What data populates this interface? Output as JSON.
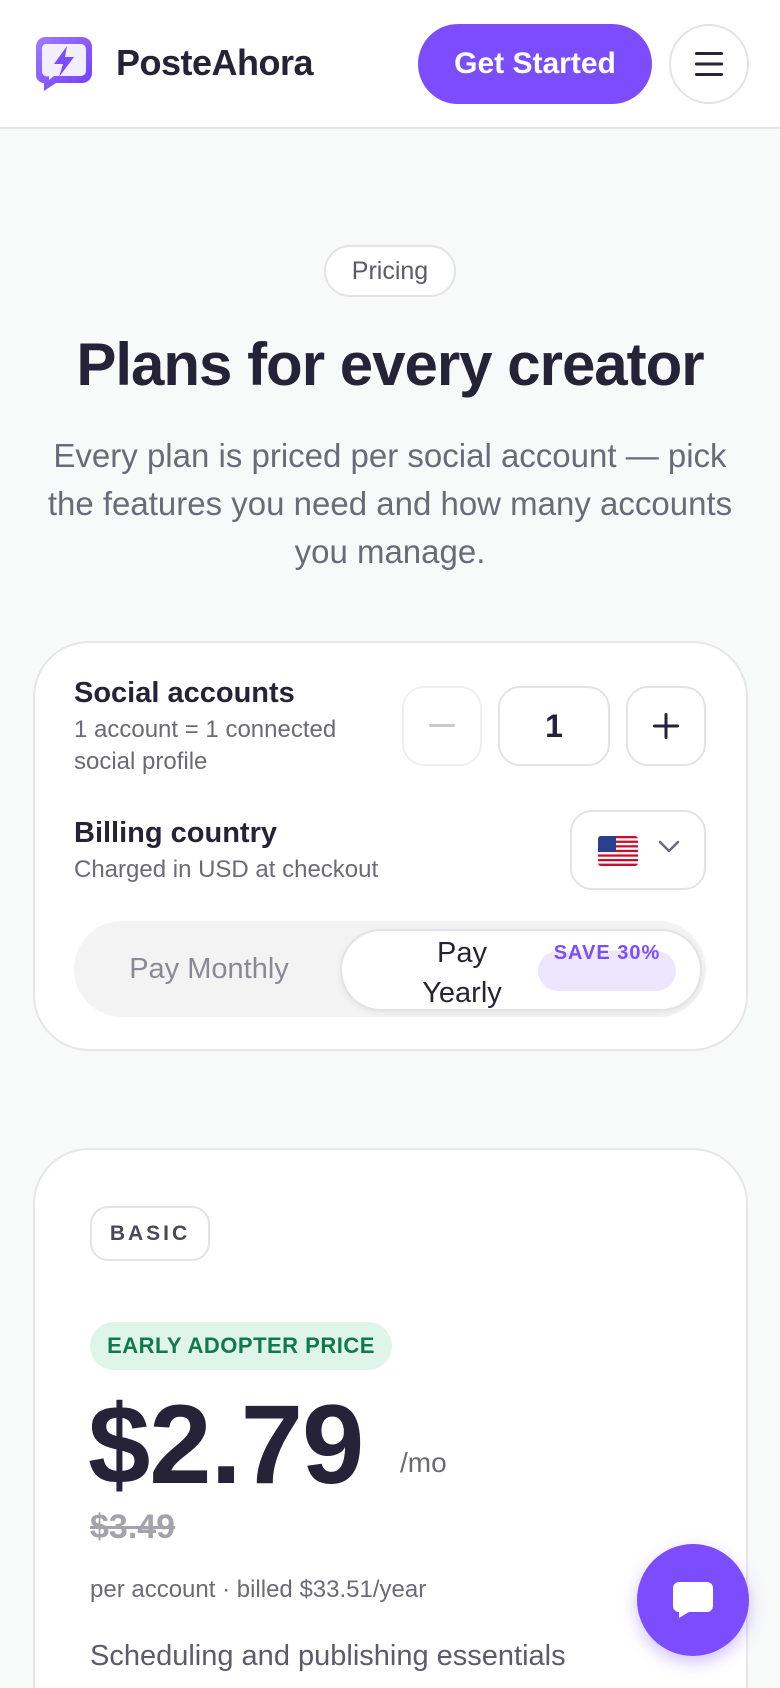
{
  "header": {
    "brand": "PosteAhora",
    "cta_label": "Get Started",
    "logo_icon": "lightning-chat-icon",
    "menu_icon": "hamburger-menu-icon",
    "accent": "#7c4dff"
  },
  "hero": {
    "pill": "Pricing",
    "title": "Plans for every creator",
    "subtitle": "Every plan is priced per social account — pick the features you need and how many accounts you manage."
  },
  "config": {
    "accounts_label": "Social accounts",
    "accounts_help": "1 account = 1 connected social profile",
    "accounts_value": "1",
    "minus_icon": "minus-icon",
    "plus_icon": "plus-icon",
    "country_label": "Billing country",
    "country_help": "Charged in USD at checkout",
    "country_flag": "us-flag-icon",
    "toggle": {
      "monthly": "Pay Monthly",
      "yearly": "Pay Yearly",
      "save": "SAVE 30%",
      "selected": "yearly"
    }
  },
  "plan": {
    "name": "BASIC",
    "badge": "EARLY ADOPTER PRICE",
    "price": "$2.79",
    "per": "/mo",
    "old_price": "$3.49",
    "billing_note": "per account · billed $33.51/year",
    "description": "Scheduling and publishing essentials"
  },
  "chat": {
    "icon": "chat-bubble-icon"
  }
}
